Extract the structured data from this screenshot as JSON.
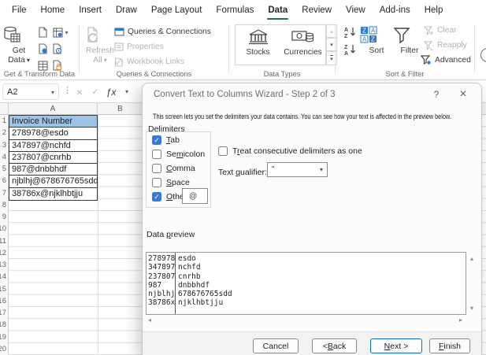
{
  "colors": {
    "tab_accent_green": "#217346",
    "header_fill_blue": "#9dc3e6",
    "checkbox_blue": "#3778d7",
    "default_button_blue": "#0f6cbd"
  },
  "icons": {
    "dropdown-chevron": "▾",
    "up-arrow": "▴",
    "down-arrow": "▾",
    "left-arrow": "◂",
    "right-arrow": "▸",
    "cancel-x": "×",
    "check": "✓",
    "function-fx": "ƒx",
    "help": "?",
    "close": "×",
    "more-dots": "⋮"
  },
  "ribbon": {
    "tabs": [
      {
        "label": "File"
      },
      {
        "label": "Home"
      },
      {
        "label": "Insert"
      },
      {
        "label": "Draw"
      },
      {
        "label": "Page Layout"
      },
      {
        "label": "Formulas"
      },
      {
        "label": "Data",
        "active": true
      },
      {
        "label": "Review"
      },
      {
        "label": "View"
      },
      {
        "label": "Add-ins"
      },
      {
        "label": "Help"
      }
    ],
    "get_transform": {
      "label": "Get & Transform Data",
      "button_line1": "Get",
      "button_line2": "Data"
    },
    "queries": {
      "label": "Queries & Connections",
      "refresh_line1": "Refresh",
      "refresh_line2": "All",
      "items": [
        {
          "label": "Queries & Connections",
          "enabled": true
        },
        {
          "label": "Properties",
          "enabled": false
        },
        {
          "label": "Workbook Links",
          "enabled": false
        }
      ]
    },
    "data_types": {
      "label": "Data Types",
      "items": [
        {
          "label": "Stocks"
        },
        {
          "label": "Currencies"
        }
      ]
    },
    "sort_filter": {
      "label": "Sort & Filter",
      "sort": "Sort",
      "filter": "Filter",
      "items": [
        {
          "label": "Clear",
          "enabled": false
        },
        {
          "label": "Reapply",
          "enabled": false
        },
        {
          "label": "Advanced",
          "enabled": true
        }
      ]
    }
  },
  "formula_bar": {
    "name_box": "A2"
  },
  "grid": {
    "columns": [
      "A",
      "B"
    ],
    "row_numbers": [
      1,
      2,
      3,
      4,
      5,
      6,
      7,
      8,
      9,
      10,
      11,
      12,
      13,
      14,
      15,
      16,
      17,
      18,
      19,
      20
    ],
    "cells": [
      "Invoice Number",
      "278978@esdo",
      "347897@nchfd",
      "237807@cnrhb",
      "987@dnbbhdf",
      "njblhj@678676765sdd",
      "38786x@njklhbtjju"
    ]
  },
  "dialog": {
    "title": "Convert Text to Columns Wizard - Step 2 of 3",
    "description": "This screen lets you set the delimiters your data contains.  You can see how your text is affected in the preview below.",
    "delimiters": {
      "legend": "Delimiters",
      "items": [
        {
          "text": "Tab",
          "mn": 0,
          "checked": true
        },
        {
          "text": "Semicolon",
          "mn": 2,
          "checked": false
        },
        {
          "text": "Comma",
          "mn": 0,
          "checked": false
        },
        {
          "text": "Space",
          "mn": 0,
          "checked": false
        },
        {
          "text": "Other:",
          "mn": 0,
          "checked": true
        }
      ],
      "other_value": "@"
    },
    "treat": {
      "text": "Treat consecutive delimiters as one",
      "mn": 1,
      "checked": false
    },
    "qualifier": {
      "label": {
        "text": "Text qualifier:",
        "mn": 5
      },
      "value": "\""
    },
    "preview": {
      "label": {
        "text": "Data preview",
        "mn": 5
      },
      "col1": [
        "278978",
        "347897",
        "237807",
        "987",
        "njblhj",
        "38786x"
      ],
      "col2": [
        "esdo",
        "nchfd",
        "cnrhb",
        "dnbbhdf",
        "678676765sdd",
        "njklhbtjju"
      ]
    },
    "buttons": {
      "cancel": {
        "text": "Cancel",
        "mn": -1
      },
      "back": {
        "text": "< Back",
        "mn": 2
      },
      "next": {
        "text": "Next >",
        "mn": 0
      },
      "finish": {
        "text": "Finish",
        "mn": 0
      }
    }
  }
}
